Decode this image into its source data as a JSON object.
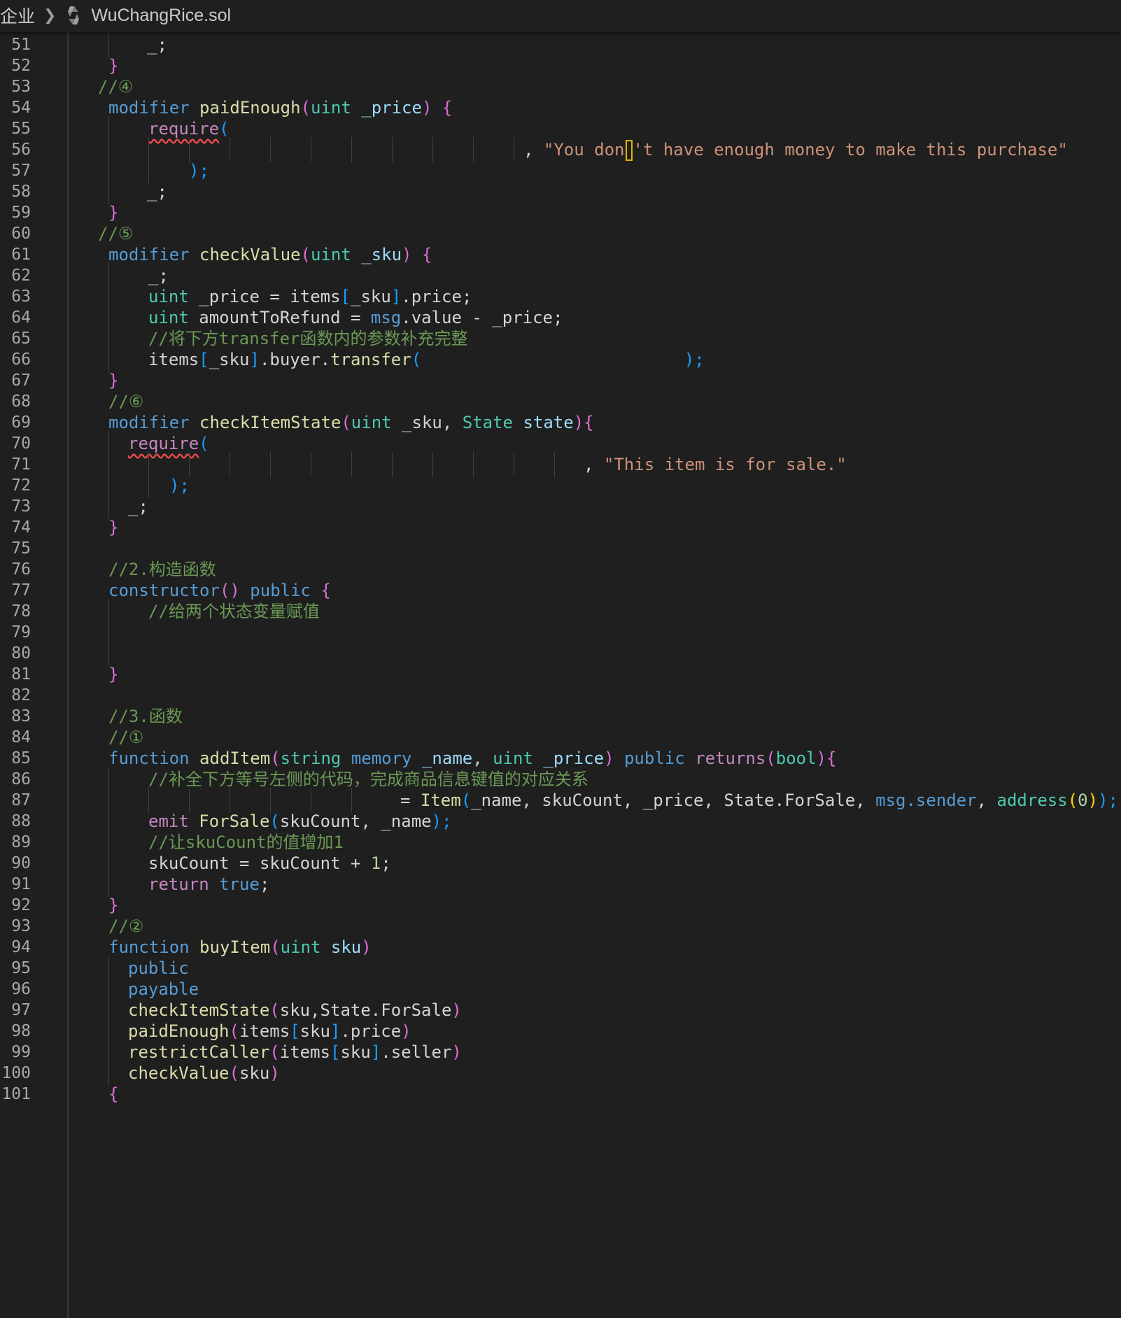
{
  "breadcrumb": {
    "folder": "企业",
    "file": "WuChangRice.sol",
    "file_icon": "solidity-file-icon"
  },
  "editor": {
    "language": "solidity",
    "cursor_line": 56,
    "lines": [
      {
        "n": "51",
        "t": [
          [
            "_;",
            "pun"
          ]
        ]
      },
      {
        "n": "52",
        "t": [
          [
            "}",
            "br2"
          ]
        ]
      },
      {
        "n": "53",
        "t": [
          [
            "//④",
            "com"
          ]
        ]
      },
      {
        "n": "54",
        "t": [
          [
            "modifier ",
            "kw"
          ],
          [
            "paidEnough",
            "fn"
          ],
          [
            "(",
            "br2"
          ],
          [
            "uint ",
            "ty"
          ],
          [
            "_price",
            "var"
          ],
          [
            ") {",
            "br2"
          ]
        ]
      },
      {
        "n": "55",
        "t": [
          [
            "require",
            "ctl"
          ],
          [
            "(",
            "br3"
          ]
        ]
      },
      {
        "n": "56",
        "t": [
          [
            ", ",
            "pun"
          ],
          [
            "\"You don",
            "str"
          ],
          [
            "CURSOR",
            "cur"
          ],
          [
            "'t have enough money to make this purchase\"",
            "str"
          ]
        ]
      },
      {
        "n": "57",
        "t": [
          [
            ");",
            "br3"
          ]
        ]
      },
      {
        "n": "58",
        "t": [
          [
            "_;",
            "pun"
          ]
        ]
      },
      {
        "n": "59",
        "t": [
          [
            "}",
            "br2"
          ]
        ]
      },
      {
        "n": "60",
        "t": [
          [
            "//⑤",
            "com"
          ]
        ]
      },
      {
        "n": "61",
        "t": [
          [
            "modifier ",
            "kw"
          ],
          [
            "checkValue",
            "fn"
          ],
          [
            "(",
            "br2"
          ],
          [
            "uint ",
            "ty"
          ],
          [
            "_sku",
            "var"
          ],
          [
            ") {",
            "br2"
          ]
        ]
      },
      {
        "n": "62",
        "t": [
          [
            "_;",
            "pun"
          ]
        ]
      },
      {
        "n": "63",
        "t": [
          [
            "uint ",
            "ty"
          ],
          [
            "_price = items",
            "pun"
          ],
          [
            "[",
            "br3"
          ],
          [
            "_sku",
            "pun"
          ],
          [
            "]",
            "br3"
          ],
          [
            ".price;",
            "pun"
          ]
        ]
      },
      {
        "n": "64",
        "t": [
          [
            "uint ",
            "ty"
          ],
          [
            "amountToRefund = ",
            "pun"
          ],
          [
            "msg",
            "kw"
          ],
          [
            ".value - _price;",
            "pun"
          ]
        ]
      },
      {
        "n": "65",
        "t": [
          [
            "//将下方transfer函数内的参数补充完整",
            "com"
          ]
        ]
      },
      {
        "n": "66",
        "t": [
          [
            "items",
            "pun"
          ],
          [
            "[",
            "br3"
          ],
          [
            "_sku",
            "pun"
          ],
          [
            "]",
            "br3"
          ],
          [
            ".buyer.",
            "pun"
          ],
          [
            "transfer",
            "fn"
          ],
          [
            "(",
            "br3"
          ],
          [
            "                          ",
            "pun"
          ],
          [
            ");",
            "br3"
          ]
        ]
      },
      {
        "n": "67",
        "t": [
          [
            "}",
            "br2"
          ]
        ]
      },
      {
        "n": "68",
        "t": [
          [
            "//⑥",
            "com"
          ]
        ]
      },
      {
        "n": "69",
        "t": [
          [
            "modifier ",
            "kw"
          ],
          [
            "checkItemState",
            "fn"
          ],
          [
            "(",
            "br2"
          ],
          [
            "uint ",
            "ty"
          ],
          [
            "_sku, ",
            "pun"
          ],
          [
            "State ",
            "ty"
          ],
          [
            "state",
            "var"
          ],
          [
            "){",
            "br2"
          ]
        ]
      },
      {
        "n": "70",
        "t": [
          [
            "require",
            "ctl"
          ],
          [
            "(",
            "br3"
          ]
        ]
      },
      {
        "n": "71",
        "t": [
          [
            ", ",
            "pun"
          ],
          [
            "\"This item is for sale.\"",
            "str"
          ]
        ]
      },
      {
        "n": "72",
        "t": [
          [
            ");",
            "br3"
          ]
        ]
      },
      {
        "n": "73",
        "t": [
          [
            "_;",
            "pun"
          ]
        ]
      },
      {
        "n": "74",
        "t": [
          [
            "}",
            "br2"
          ]
        ]
      },
      {
        "n": "75",
        "t": []
      },
      {
        "n": "76",
        "t": [
          [
            "//2.构造函数",
            "com"
          ]
        ]
      },
      {
        "n": "77",
        "t": [
          [
            "constructor",
            "kw"
          ],
          [
            "()",
            "br2"
          ],
          [
            " public ",
            "kw"
          ],
          [
            "{",
            "br2"
          ]
        ]
      },
      {
        "n": "78",
        "t": [
          [
            "//给两个状态变量赋值",
            "com"
          ]
        ]
      },
      {
        "n": "79",
        "t": []
      },
      {
        "n": "80",
        "t": []
      },
      {
        "n": "81",
        "t": [
          [
            "}",
            "br2"
          ]
        ]
      },
      {
        "n": "82",
        "t": []
      },
      {
        "n": "83",
        "t": [
          [
            "//3.函数",
            "com"
          ]
        ]
      },
      {
        "n": "84",
        "t": [
          [
            "//①",
            "com"
          ]
        ]
      },
      {
        "n": "85",
        "t": [
          [
            "function ",
            "kw"
          ],
          [
            "addItem",
            "fn"
          ],
          [
            "(",
            "br2"
          ],
          [
            "string ",
            "ty"
          ],
          [
            "memory ",
            "kw"
          ],
          [
            "_name",
            "var"
          ],
          [
            ", ",
            "pun"
          ],
          [
            "uint ",
            "ty"
          ],
          [
            "_price",
            "var"
          ],
          [
            ") ",
            "br2"
          ],
          [
            "public ",
            "kw"
          ],
          [
            "returns",
            "ctl"
          ],
          [
            "(",
            "br2"
          ],
          [
            "bool",
            "ty"
          ],
          [
            "){",
            "br2"
          ]
        ]
      },
      {
        "n": "86",
        "t": [
          [
            "//补全下方等号左侧的代码，完成商品信息键值的对应关系",
            "com"
          ]
        ]
      },
      {
        "n": "87",
        "t": [
          [
            "= ",
            "pun"
          ],
          [
            "Item",
            "fn"
          ],
          [
            "(",
            "br3"
          ],
          [
            "_name, skuCount, _price, State.ForSale, ",
            "pun"
          ],
          [
            "msg.sender",
            "kw"
          ],
          [
            ", ",
            "pun"
          ],
          [
            "address",
            "ty"
          ],
          [
            "(",
            "br1"
          ],
          [
            "0",
            "num"
          ],
          [
            ")",
            "br1"
          ],
          [
            ");",
            "br3"
          ]
        ]
      },
      {
        "n": "88",
        "t": [
          [
            "emit ",
            "ctl"
          ],
          [
            "ForSale",
            "fn"
          ],
          [
            "(",
            "br3"
          ],
          [
            "skuCount, _name",
            "pun"
          ],
          [
            ");",
            "br3"
          ]
        ]
      },
      {
        "n": "89",
        "t": [
          [
            "//让skuCount的值增加1",
            "com"
          ]
        ]
      },
      {
        "n": "90",
        "t": [
          [
            "skuCount = skuCount + ",
            "pun"
          ],
          [
            "1",
            "num"
          ],
          [
            ";",
            "pun"
          ]
        ]
      },
      {
        "n": "91",
        "t": [
          [
            "return ",
            "ctl"
          ],
          [
            "true",
            "kw"
          ],
          [
            ";",
            "pun"
          ]
        ]
      },
      {
        "n": "92",
        "t": [
          [
            "}",
            "br2"
          ]
        ]
      },
      {
        "n": "93",
        "t": [
          [
            "//②",
            "com"
          ]
        ]
      },
      {
        "n": "94",
        "t": [
          [
            "function ",
            "kw"
          ],
          [
            "buyItem",
            "fn"
          ],
          [
            "(",
            "br2"
          ],
          [
            "uint ",
            "ty"
          ],
          [
            "sku",
            "var"
          ],
          [
            ")",
            "br2"
          ]
        ]
      },
      {
        "n": "95",
        "t": [
          [
            "public",
            "kw"
          ]
        ]
      },
      {
        "n": "96",
        "t": [
          [
            "payable",
            "kw"
          ]
        ]
      },
      {
        "n": "97",
        "t": [
          [
            "checkItemState",
            "fn"
          ],
          [
            "(",
            "br2"
          ],
          [
            "sku,State.ForSale",
            "pun"
          ],
          [
            ")",
            "br2"
          ]
        ]
      },
      {
        "n": "98",
        "t": [
          [
            "paidEnough",
            "fn"
          ],
          [
            "(",
            "br2"
          ],
          [
            "items",
            "pun"
          ],
          [
            "[",
            "br3"
          ],
          [
            "sku",
            "pun"
          ],
          [
            "]",
            "br3"
          ],
          [
            ".price",
            "pun"
          ],
          [
            ")",
            "br2"
          ]
        ]
      },
      {
        "n": "99",
        "t": [
          [
            "restrictCaller",
            "fn"
          ],
          [
            "(",
            "br2"
          ],
          [
            "items",
            "pun"
          ],
          [
            "[",
            "br3"
          ],
          [
            "sku",
            "pun"
          ],
          [
            "]",
            "br3"
          ],
          [
            ".seller",
            "pun"
          ],
          [
            ")",
            "br2"
          ]
        ]
      },
      {
        "n": "100",
        "t": [
          [
            "checkValue",
            "fn"
          ],
          [
            "(",
            "br2"
          ],
          [
            "sku",
            "pun"
          ],
          [
            ")",
            "br2"
          ]
        ]
      },
      {
        "n": "101",
        "t": [
          [
            "{",
            "br2"
          ]
        ]
      }
    ]
  }
}
